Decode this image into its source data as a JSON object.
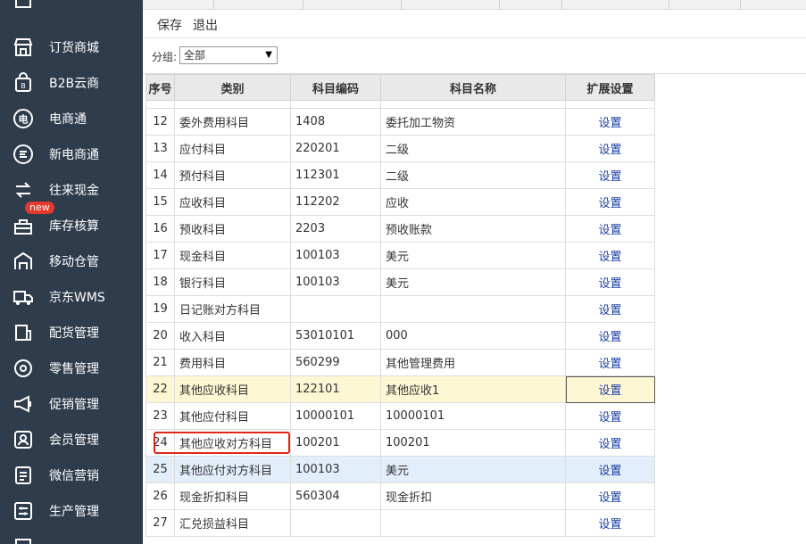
{
  "sidebar": {
    "items": [
      {
        "label": "",
        "icon": "doc-icon"
      },
      {
        "label": "订货商城",
        "icon": "shop-icon"
      },
      {
        "label": "B2B云商",
        "icon": "bag-icon"
      },
      {
        "label": "电商通",
        "icon": "dian-icon"
      },
      {
        "label": "新电商通",
        "icon": "e-icon"
      },
      {
        "label": "往来现金",
        "icon": "exchange-icon"
      },
      {
        "label": "库存核算",
        "icon": "stock-icon",
        "badge": "new"
      },
      {
        "label": "移动仓管",
        "icon": "warehouse-icon"
      },
      {
        "label": "京东WMS",
        "icon": "truck-icon"
      },
      {
        "label": "配货管理",
        "icon": "distribution-icon"
      },
      {
        "label": "零售管理",
        "icon": "retail-icon"
      },
      {
        "label": "促销管理",
        "icon": "megaphone-icon"
      },
      {
        "label": "会员管理",
        "icon": "member-icon"
      },
      {
        "label": "微信营销",
        "icon": "wechat-icon"
      },
      {
        "label": "生产管理",
        "icon": "production-icon"
      },
      {
        "label": "",
        "icon": "misc-icon"
      }
    ]
  },
  "toolbar": {
    "save_label": "保存",
    "exit_label": "退出"
  },
  "filter": {
    "label": "分组:",
    "selected": "全部"
  },
  "table": {
    "headers": [
      "序号",
      "类别",
      "科目编码",
      "科目名称",
      "扩展设置"
    ],
    "rows": [
      {
        "no": "12",
        "category": "委外费用科目",
        "code": "1408",
        "name": "委托加工物资",
        "action": "设置"
      },
      {
        "no": "13",
        "category": "应付科目",
        "code": "220201",
        "name": "二级",
        "action": "设置"
      },
      {
        "no": "14",
        "category": "预付科目",
        "code": "112301",
        "name": "二级",
        "action": "设置"
      },
      {
        "no": "15",
        "category": "应收科目",
        "code": "112202",
        "name": "应收",
        "action": "设置"
      },
      {
        "no": "16",
        "category": "预收科目",
        "code": "2203",
        "name": "预收账款",
        "action": "设置"
      },
      {
        "no": "17",
        "category": "现金科目",
        "code": "100103",
        "name": "美元",
        "action": "设置"
      },
      {
        "no": "18",
        "category": "银行科目",
        "code": "100103",
        "name": "美元",
        "action": "设置"
      },
      {
        "no": "19",
        "category": "日记账对方科目",
        "code": "",
        "name": "",
        "action": "设置"
      },
      {
        "no": "20",
        "category": "收入科目",
        "code": "53010101",
        "name": "000",
        "action": "设置"
      },
      {
        "no": "21",
        "category": "费用科目",
        "code": "560299",
        "name": "其他管理费用",
        "action": "设置"
      },
      {
        "no": "22",
        "category": "其他应收科目",
        "code": "122101",
        "name": "其他应收1",
        "action": "设置"
      },
      {
        "no": "23",
        "category": "其他应付科目",
        "code": "10000101",
        "name": "10000101",
        "action": "设置"
      },
      {
        "no": "24",
        "category": "其他应收对方科目",
        "code": "100201",
        "name": "100201",
        "action": "设置"
      },
      {
        "no": "25",
        "category": "其他应付对方科目",
        "code": "100103",
        "name": "美元",
        "action": "设置"
      },
      {
        "no": "26",
        "category": "现金折扣科目",
        "code": "560304",
        "name": "现金折扣",
        "action": "设置"
      },
      {
        "no": "27",
        "category": "汇兑损益科目",
        "code": "",
        "name": "",
        "action": "设置"
      }
    ]
  },
  "colors": {
    "sidebar_bg": "#2f3c4c",
    "highlight": "#e0261b",
    "link": "#1a3fa6"
  }
}
